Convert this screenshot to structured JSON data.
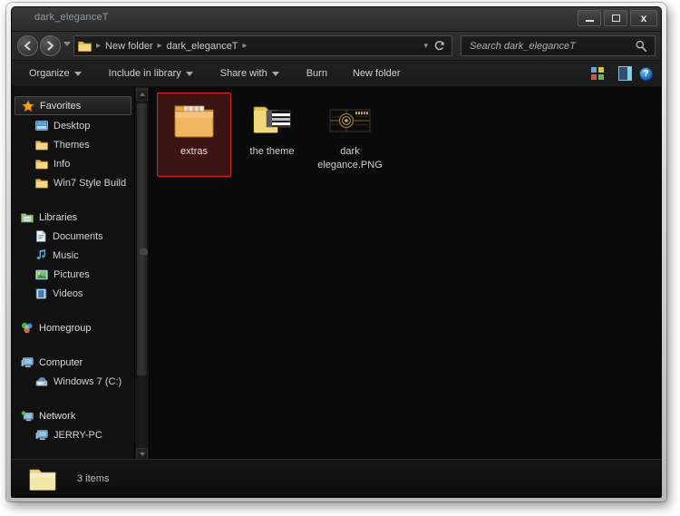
{
  "window": {
    "title": "dark_eleganceT",
    "controls": {
      "minimize": "Minimize",
      "maximize": "Maximize",
      "close": "Close"
    }
  },
  "navbar": {
    "back": "Back",
    "forward": "Forward",
    "recent_pages": "Recent Pages",
    "breadcrumbs": [
      "New folder",
      "dark_eleganceT"
    ],
    "separator": "▸",
    "refresh": "Refresh",
    "search": {
      "placeholder": "Search dark_eleganceT",
      "value": ""
    }
  },
  "command_bar": {
    "items": [
      {
        "label": "Organize",
        "has_caret": true
      },
      {
        "label": "Include in library",
        "has_caret": true
      },
      {
        "label": "Share with",
        "has_caret": true
      },
      {
        "label": "Burn",
        "has_caret": false
      },
      {
        "label": "New folder",
        "has_caret": false
      }
    ],
    "right": {
      "change_view": "Change your view",
      "view_caret": "More options",
      "preview_pane": "Show the preview pane",
      "help": "?"
    }
  },
  "sidebar": {
    "groups": [
      {
        "root": {
          "label": "Favorites",
          "icon": "star-icon",
          "selected": true
        },
        "items": [
          {
            "label": "Desktop",
            "icon": "desktop-icon"
          },
          {
            "label": "Themes",
            "icon": "folder-icon"
          },
          {
            "label": "Info",
            "icon": "folder-icon"
          },
          {
            "label": "Win7 Style Build",
            "icon": "folder-icon"
          }
        ]
      },
      {
        "root": {
          "label": "Libraries",
          "icon": "libraries-icon",
          "selected": false
        },
        "items": [
          {
            "label": "Documents",
            "icon": "document-icon"
          },
          {
            "label": "Music",
            "icon": "music-note-icon"
          },
          {
            "label": "Pictures",
            "icon": "picture-icon"
          },
          {
            "label": "Videos",
            "icon": "video-icon"
          }
        ]
      },
      {
        "root": {
          "label": "Homegroup",
          "icon": "homegroup-icon",
          "selected": false
        },
        "items": []
      },
      {
        "root": {
          "label": "Computer",
          "icon": "computer-icon",
          "selected": false
        },
        "items": [
          {
            "label": "Windows 7 (C:)",
            "icon": "harddisk-icon"
          }
        ]
      },
      {
        "root": {
          "label": "Network",
          "icon": "network-icon",
          "selected": false
        },
        "items": [
          {
            "label": "JERRY-PC",
            "icon": "computer-icon"
          }
        ]
      }
    ],
    "scrollbar": {
      "up": "Scroll up",
      "down": "Scroll down"
    }
  },
  "content": {
    "files": [
      {
        "name": "extras",
        "type": "folder",
        "icon": "folder-open-files-icon",
        "selected": true
      },
      {
        "name": "the theme",
        "type": "folder",
        "icon": "folder-theme-icon",
        "selected": false
      },
      {
        "name": "dark elegance.PNG",
        "type": "image",
        "icon": "png-thumbnail",
        "selected": false
      }
    ]
  },
  "status_bar": {
    "icon": "folder-icon",
    "text": "3 items"
  },
  "colors": {
    "selection_fill": "#3d1414",
    "selection_border": "#e02020",
    "window_chrome": "#2e2e2e",
    "background": "#0a0a0a",
    "title_text": "#8d9aa6",
    "body_text": "#cfcfcf"
  }
}
